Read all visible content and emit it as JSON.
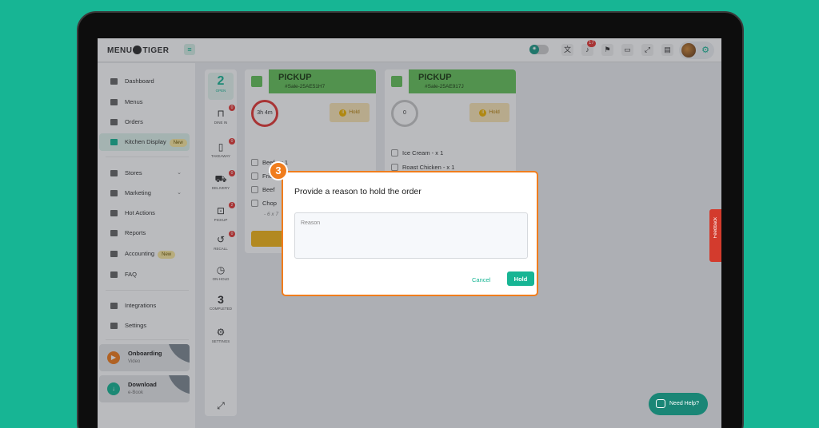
{
  "app": {
    "logo": {
      "left": "MENU",
      "right": "TIGER"
    },
    "notification_count": "17"
  },
  "sidebar": {
    "items": [
      {
        "label": "Dashboard"
      },
      {
        "label": "Menus"
      },
      {
        "label": "Orders"
      },
      {
        "label": "Kitchen Display",
        "badge": "New"
      },
      {
        "label": "Stores"
      },
      {
        "label": "Marketing"
      },
      {
        "label": "Hot Actions"
      },
      {
        "label": "Reports"
      },
      {
        "label": "Accounting",
        "badge": "New"
      },
      {
        "label": "FAQ"
      },
      {
        "label": "Integrations"
      },
      {
        "label": "Settings"
      }
    ],
    "promos": [
      {
        "title": "Onboarding",
        "subtitle": "Video"
      },
      {
        "title": "Download",
        "subtitle": "e-Book"
      }
    ]
  },
  "rail": {
    "open_count": "2",
    "open_label": "OPEN",
    "items": [
      {
        "label": "DINE IN",
        "count": "0"
      },
      {
        "label": "TAKEAWAY",
        "count": "0"
      },
      {
        "label": "DELIVERY",
        "count": "0"
      },
      {
        "label": "PICKUP",
        "count": "2"
      },
      {
        "label": "RECALL",
        "count": "0"
      },
      {
        "label": "ON-HOLD"
      }
    ],
    "completed_count": "3",
    "completed_label": "COMPLETED",
    "settings_label": "SETTINGS"
  },
  "orders": [
    {
      "type": "PICKUP",
      "ref": "#Sale-25AE51H7",
      "timer": "3h 4m",
      "hold_label": "Hold",
      "items": [
        {
          "name": "Beef - x 1"
        },
        {
          "name": "Fries"
        },
        {
          "name": "Beef"
        },
        {
          "name": "Chop"
        }
      ],
      "note": "- 6 x 7"
    },
    {
      "type": "PICKUP",
      "ref": "#Sale-25AE917J",
      "timer": "0",
      "hold_label": "Hold",
      "items": [
        {
          "name": "Ice Cream - x 1"
        },
        {
          "name": "Roast Chicken - x 1"
        }
      ]
    }
  ],
  "dialog": {
    "step": "3",
    "title": "Provide a reason to hold the order",
    "reason_placeholder": "Reason",
    "reason_value": "",
    "cancel_label": "Cancel",
    "hold_label": "Hold"
  },
  "feedback_label": "Feedback",
  "help_label": "Need Help?"
}
